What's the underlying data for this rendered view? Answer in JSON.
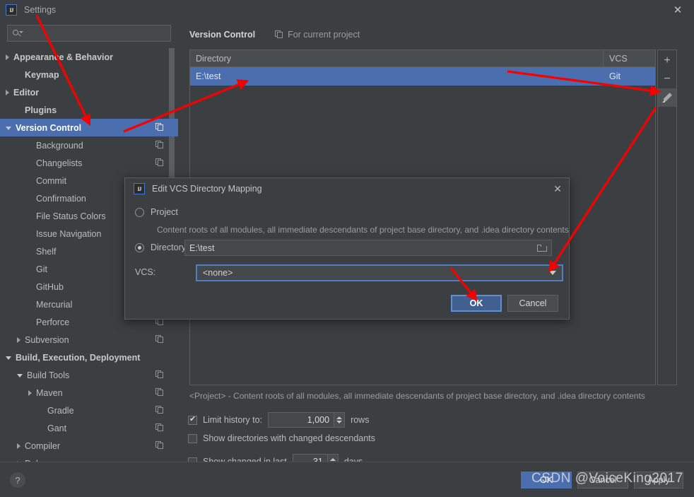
{
  "window": {
    "title": "Settings",
    "logo_text": "IJ",
    "close_icon": "close-icon"
  },
  "sidebar": {
    "search": {
      "value": "",
      "placeholder": ""
    },
    "items": [
      {
        "label": "Appearance & Behavior",
        "arrow": "right",
        "indent": 0,
        "bold": true,
        "copy": false,
        "selected": false
      },
      {
        "label": "Keymap",
        "arrow": "none",
        "indent": 1,
        "bold": true,
        "copy": false,
        "selected": false
      },
      {
        "label": "Editor",
        "arrow": "right",
        "indent": 0,
        "bold": true,
        "copy": false,
        "selected": false
      },
      {
        "label": "Plugins",
        "arrow": "none",
        "indent": 1,
        "bold": true,
        "copy": false,
        "selected": false
      },
      {
        "label": "Version Control",
        "arrow": "down",
        "indent": 0,
        "bold": true,
        "copy": true,
        "selected": true
      },
      {
        "label": "Background",
        "arrow": "none",
        "indent": 2,
        "bold": false,
        "copy": true,
        "selected": false
      },
      {
        "label": "Changelists",
        "arrow": "none",
        "indent": 2,
        "bold": false,
        "copy": true,
        "selected": false
      },
      {
        "label": "Commit",
        "arrow": "none",
        "indent": 2,
        "bold": false,
        "copy": false,
        "selected": false
      },
      {
        "label": "Confirmation",
        "arrow": "none",
        "indent": 2,
        "bold": false,
        "copy": false,
        "selected": false
      },
      {
        "label": "File Status Colors",
        "arrow": "none",
        "indent": 2,
        "bold": false,
        "copy": false,
        "selected": false
      },
      {
        "label": "Issue Navigation",
        "arrow": "none",
        "indent": 2,
        "bold": false,
        "copy": false,
        "selected": false
      },
      {
        "label": "Shelf",
        "arrow": "none",
        "indent": 2,
        "bold": false,
        "copy": false,
        "selected": false
      },
      {
        "label": "Git",
        "arrow": "none",
        "indent": 2,
        "bold": false,
        "copy": false,
        "selected": false
      },
      {
        "label": "GitHub",
        "arrow": "none",
        "indent": 2,
        "bold": false,
        "copy": false,
        "selected": false
      },
      {
        "label": "Mercurial",
        "arrow": "none",
        "indent": 2,
        "bold": false,
        "copy": false,
        "selected": false
      },
      {
        "label": "Perforce",
        "arrow": "none",
        "indent": 2,
        "bold": false,
        "copy": true,
        "selected": false
      },
      {
        "label": "Subversion",
        "arrow": "right",
        "indent": 1,
        "bold": false,
        "copy": true,
        "selected": false
      },
      {
        "label": "Build, Execution, Deployment",
        "arrow": "down",
        "indent": 0,
        "bold": true,
        "copy": false,
        "selected": false
      },
      {
        "label": "Build Tools",
        "arrow": "down",
        "indent": 1,
        "bold": false,
        "copy": true,
        "selected": false
      },
      {
        "label": "Maven",
        "arrow": "right",
        "indent": 2,
        "bold": false,
        "copy": true,
        "selected": false
      },
      {
        "label": "Gradle",
        "arrow": "none",
        "indent": 3,
        "bold": false,
        "copy": true,
        "selected": false
      },
      {
        "label": "Gant",
        "arrow": "none",
        "indent": 3,
        "bold": false,
        "copy": true,
        "selected": false
      },
      {
        "label": "Compiler",
        "arrow": "right",
        "indent": 1,
        "bold": false,
        "copy": true,
        "selected": false
      },
      {
        "label": "Debugger",
        "arrow": "right",
        "indent": 1,
        "bold": false,
        "copy": false,
        "selected": false
      }
    ]
  },
  "main": {
    "title": "Version Control",
    "for_current_project": "For current project",
    "table": {
      "columns": [
        "Directory",
        "VCS"
      ],
      "rows": [
        {
          "directory": "E:\\test",
          "vcs": "Git",
          "selected": true
        }
      ]
    },
    "tools": {
      "add": "+",
      "remove": "−",
      "edit_icon": "pencil-icon"
    },
    "hint": "<Project> - Content roots of all modules, all immediate descendants of project base directory, and .idea directory contents",
    "options": {
      "limit_history_label": "Limit history to:",
      "limit_history_checked": true,
      "limit_history_value": "1,000",
      "limit_history_suffix": "rows",
      "show_dirs_label": "Show directories with changed descendants",
      "show_dirs_checked": false,
      "show_changed_label": "Show changed in last",
      "show_changed_checked": false,
      "show_changed_value": "31",
      "show_changed_suffix": "days"
    }
  },
  "dialog": {
    "title": "Edit VCS Directory Mapping",
    "logo_text": "IJ",
    "project_label": "Project",
    "project_selected": false,
    "project_desc": "Content roots of all modules, all immediate descendants of project base directory, and .idea directory contents",
    "directory_label": "Directory:",
    "directory_selected": true,
    "directory_value": "E:\\test",
    "vcs_label": "VCS:",
    "vcs_value": "<none>",
    "ok_label": "OK",
    "cancel_label": "Cancel"
  },
  "bottom": {
    "help_label": "?",
    "ok_label": "OK",
    "cancel_label": "Cancel",
    "apply_label": "Apply",
    "watermark": "CSDN @VoiceKing2017"
  },
  "colors": {
    "accent_blue": "#4b6eaf",
    "focus_blue": "#4e7ec4",
    "annotation_red": "#f60000",
    "bg": "#3c3f41",
    "panel_bg": "#45484a"
  }
}
